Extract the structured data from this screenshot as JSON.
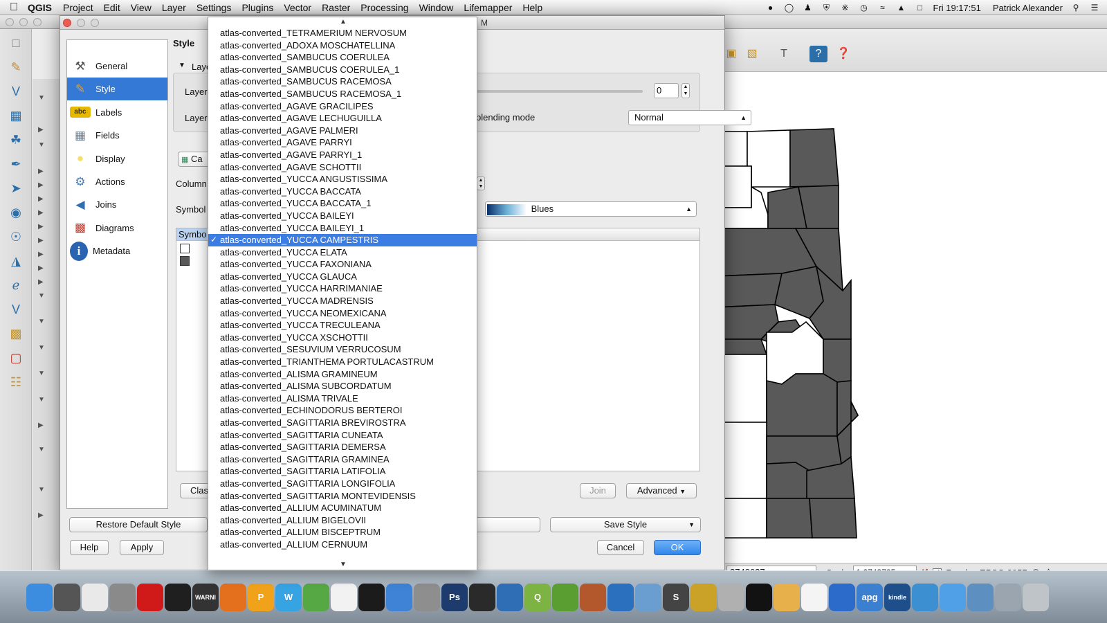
{
  "menubar": {
    "app": "QGIS",
    "items": [
      "Project",
      "Edit",
      "View",
      "Layer",
      "Settings",
      "Plugins",
      "Vector",
      "Raster",
      "Processing",
      "Window",
      "Lifemapper",
      "Help"
    ],
    "clock": "Fri 19:17:51",
    "user": "Patrick Alexander"
  },
  "dialog": {
    "title_fragment": "M",
    "nav": [
      {
        "label": "General",
        "icon": "tools-icon",
        "color": "#555555"
      },
      {
        "label": "Style",
        "icon": "paintbrush-icon",
        "color": "#d9a43a"
      },
      {
        "label": "Labels",
        "icon": "labels-icon",
        "color": "#e6b800"
      },
      {
        "label": "Fields",
        "icon": "table-icon",
        "color": "#6f7f8f"
      },
      {
        "label": "Display",
        "icon": "speech-bubble-icon",
        "color": "#f3df6a"
      },
      {
        "label": "Actions",
        "icon": "gear-icon",
        "color": "#4a7fb5"
      },
      {
        "label": "Joins",
        "icon": "join-icon",
        "color": "#2f6fb0"
      },
      {
        "label": "Diagrams",
        "icon": "diagram-icon",
        "color": "#c0392b"
      },
      {
        "label": "Metadata",
        "icon": "info-icon",
        "color": "#2a64b0"
      }
    ],
    "selected_nav_index": 1,
    "style_heading": "Style",
    "layer_section_label": "Laye",
    "layer_label_1": "Layer",
    "layer_label_2": "Layer",
    "transparency_value": "0",
    "blending_label": "blending mode",
    "blending_value": "Normal",
    "categorized_button": "Ca",
    "column_label": "Column",
    "symbol_label": "Symbol",
    "color_ramp_value": "Blues",
    "symbol_header": "Symbo",
    "classify_button": "Clas",
    "join_button": "Join",
    "advanced_button": "Advanced",
    "restore_button": "Restore Default Style",
    "load_style_button": "... e",
    "save_style_button": "Save Style",
    "help_button": "Help",
    "apply_button": "Apply",
    "cancel_button": "Cancel",
    "ok_button": "OK"
  },
  "dropdown": {
    "items": [
      "atlas-converted_TETRAMERIUM  NERVOSUM",
      "atlas-converted_ADOXA MOSCHATELLINA",
      "atlas-converted_SAMBUCUS COERULEA",
      "atlas-converted_SAMBUCUS COERULEA_1",
      "atlas-converted_SAMBUCUS RACEMOSA",
      "atlas-converted_SAMBUCUS RACEMOSA_1",
      "atlas-converted_AGAVE GRACILIPES",
      "atlas-converted_AGAVE LECHUGUILLA",
      "atlas-converted_AGAVE PALMERI",
      "atlas-converted_AGAVE PARRYI",
      "atlas-converted_AGAVE PARRYI_1",
      "atlas-converted_AGAVE SCHOTTII",
      "atlas-converted_YUCCA ANGUSTISSIMA",
      "atlas-converted_YUCCA BACCATA",
      "atlas-converted_YUCCA BACCATA_1",
      "atlas-converted_YUCCA BAILEYI",
      "atlas-converted_YUCCA BAILEYI_1",
      "atlas-converted_YUCCA CAMPESTRIS",
      "atlas-converted_YUCCA ELATA",
      "atlas-converted_YUCCA FAXONIANA",
      "atlas-converted_YUCCA GLAUCA",
      "atlas-converted_YUCCA HARRIMANIAE",
      "atlas-converted_YUCCA MADRENSIS",
      "atlas-converted_YUCCA NEOMEXICANA",
      "atlas-converted_YUCCA TRECULEANA",
      "atlas-converted_YUCCA XSCHOTTII",
      "atlas-converted_SESUVIUM VERRUCOSUM",
      "atlas-converted_TRIANTHEMA  PORTULACASTRUM",
      "atlas-converted_ALISMA GRAMINEUM",
      "atlas-converted_ALISMA SUBCORDATUM",
      "atlas-converted_ALISMA TRIVALE",
      "atlas-converted_ECHINODORUS BERTEROI",
      "atlas-converted_SAGITTARIA BREVIROSTRA",
      "atlas-converted_SAGITTARIA CUNEATA",
      "atlas-converted_SAGITTARIA DEMERSA",
      "atlas-converted_SAGITTARIA GRAMINEA",
      "atlas-converted_SAGITTARIA LATIFOLIA",
      "atlas-converted_SAGITTARIA LONGIFOLIA",
      "atlas-converted_SAGITTARIA MONTEVIDENSIS",
      "atlas-converted_ALLIUM ACUMINATUM",
      "atlas-converted_ALLIUM BIGELOVII",
      "atlas-converted_ALLIUM BISCEPTRUM",
      "atlas-converted_ALLIUM CERNUUM"
    ],
    "selected_index": 17
  },
  "statusbar": {
    "coordinate": "3748637",
    "scale_label": "Scale",
    "scale_value": "1:2743725",
    "render_label": "Render",
    "crs": "EPSG:2957"
  },
  "map": {
    "fill_color": "#595959",
    "empty_color": "#ffffff"
  },
  "dock": {
    "icons": [
      {
        "name": "finder-icon",
        "text": "",
        "color": "#3c8de0"
      },
      {
        "name": "clock-icon",
        "text": "",
        "color": "#555555"
      },
      {
        "name": "notes-icon",
        "text": "",
        "color": "#e9e9e9"
      },
      {
        "name": "scanner-icon",
        "text": "",
        "color": "#8a8a8a"
      },
      {
        "name": "opera-icon",
        "text": "",
        "color": "#d01a1a"
      },
      {
        "name": "activity-monitor-icon",
        "text": "",
        "color": "#1f1f1f"
      },
      {
        "name": "console-icon",
        "text": "WARNI",
        "color": "#333333"
      },
      {
        "name": "firefox-icon",
        "text": "",
        "color": "#e4701e"
      },
      {
        "name": "pages-icon",
        "text": "P",
        "color": "#f0a21a"
      },
      {
        "name": "word-icon",
        "text": "W",
        "color": "#36a3e3"
      },
      {
        "name": "plant-icon",
        "text": "",
        "color": "#56a845"
      },
      {
        "name": "document-icon",
        "text": "",
        "color": "#f2f2f2"
      },
      {
        "name": "terminal-icon",
        "text": "",
        "color": "#1b1b1b"
      },
      {
        "name": "itunes-icon",
        "text": "",
        "color": "#3e83d6"
      },
      {
        "name": "system-preferences-icon",
        "text": "",
        "color": "#8e8e8e"
      },
      {
        "name": "photoshop-icon",
        "text": "Ps",
        "color": "#1e3b6e"
      },
      {
        "name": "inkscape-icon",
        "text": "",
        "color": "#2a2a2a"
      },
      {
        "name": "thunderbird-icon",
        "text": "",
        "color": "#2f6db5"
      },
      {
        "name": "qgis-icon",
        "text": "Q",
        "color": "#7cb342"
      },
      {
        "name": "grass-icon",
        "text": "",
        "color": "#5a9e32"
      },
      {
        "name": "sketchup-icon",
        "text": "",
        "color": "#b3582d"
      },
      {
        "name": "preview-icon",
        "text": "",
        "color": "#2b6fbf"
      },
      {
        "name": "mail-icon",
        "text": "",
        "color": "#6a9dd0"
      },
      {
        "name": "skype-icon",
        "text": "S",
        "color": "#444444"
      },
      {
        "name": "keychain-icon",
        "text": "",
        "color": "#c9a227"
      },
      {
        "name": "dvd-player-icon",
        "text": "",
        "color": "#b0b0b0"
      },
      {
        "name": "camera-icon",
        "text": "",
        "color": "#121212"
      },
      {
        "name": "safari-icon",
        "text": "",
        "color": "#e8b04a"
      },
      {
        "name": "acrobat-icon",
        "text": "",
        "color": "#f4f4f4"
      },
      {
        "name": "frame-icon",
        "text": "",
        "color": "#2c6bc9"
      },
      {
        "name": "apg-icon",
        "text": "apg",
        "color": "#3a7fd0"
      },
      {
        "name": "kindle-icon",
        "text": "kindle",
        "color": "#1f4f8a"
      },
      {
        "name": "browser-icon",
        "text": "",
        "color": "#3c8fd1"
      },
      {
        "name": "messages-icon",
        "text": "",
        "color": "#4fa0e6"
      },
      {
        "name": "network-icon",
        "text": "",
        "color": "#5d8fc0"
      },
      {
        "name": "downloads-icon",
        "text": "",
        "color": "#9aa5b0"
      },
      {
        "name": "trash-icon",
        "text": "",
        "color": "#bfc4c8"
      }
    ]
  }
}
